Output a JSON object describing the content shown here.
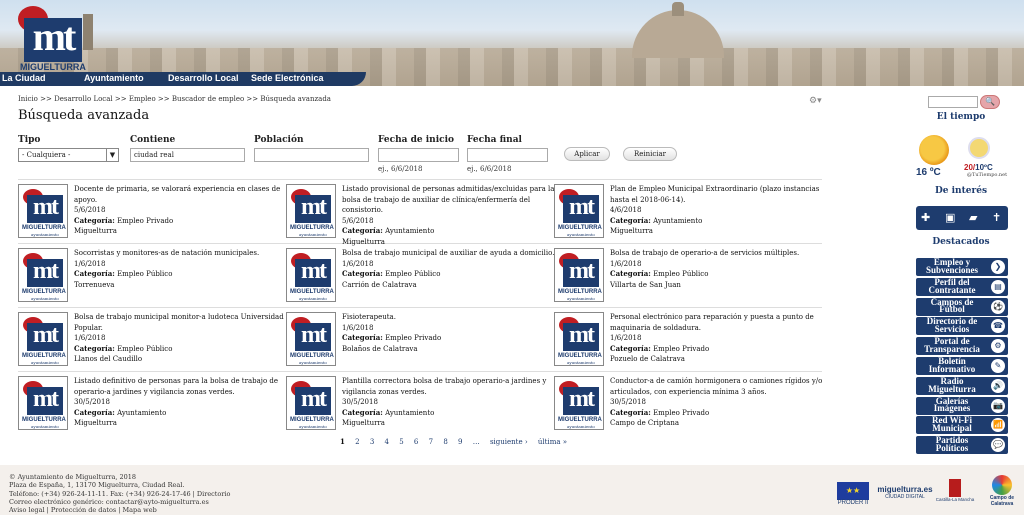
{
  "header": {
    "logo_text": "mt",
    "logo_name": "MIGUELTURRA",
    "nav": [
      {
        "label": "La Ciudad"
      },
      {
        "label": "Ayuntamiento"
      },
      {
        "label": "Desarrollo Local"
      },
      {
        "label": "Sede Electrónica"
      }
    ]
  },
  "breadcrumb": {
    "items": [
      "Inicio",
      ">>",
      "Desarrollo Local",
      ">>",
      "Empleo",
      ">>",
      "Buscador de empleo",
      ">>",
      "Búsqueda avanzada"
    ]
  },
  "page_title": "Búsqueda avanzada",
  "filters": {
    "tipo_label": "Tipo",
    "tipo_value": "- Cualquiera -",
    "contiene_label": "Contiene",
    "contiene_value": "ciudad real",
    "poblacion_label": "Población",
    "poblacion_value": "",
    "fecha_inicio_label": "Fecha de inicio",
    "fecha_inicio_hint": "ej., 6/6/2018",
    "fecha_final_label": "Fecha final",
    "fecha_final_hint": "ej., 6/6/2018",
    "apply_label": "Aplicar",
    "reset_label": "Reiniciar"
  },
  "thumb": {
    "text": "mt",
    "name": "MIGUELTURRA",
    "sub": "ayuntamiento"
  },
  "results": [
    {
      "title": "Docente de primaria, se valorará experiencia en clases de apoyo.",
      "date": "5/6/2018",
      "category_label": "Categoría:",
      "category": "Empleo Privado",
      "place": "Miguelturra"
    },
    {
      "title": "Listado provisional de personas admitidas/excluidas para la bolsa de trabajo de auxiliar de clínica/enfermería del consistorio.",
      "date": "5/6/2018",
      "category_label": "Categoría:",
      "category": "Ayuntamiento",
      "place": "Miguelturra"
    },
    {
      "title": "Plan de Empleo Municipal Extraordinario (plazo instancias hasta el 2018-06-14).",
      "date": "4/6/2018",
      "category_label": "Categoría:",
      "category": "Ayuntamiento",
      "place": "Miguelturra"
    },
    {
      "title": "Socorristas y monitores-as de natación municipales.",
      "date": "1/6/2018",
      "category_label": "Categoría:",
      "category": "Empleo Público",
      "place": "Torrenueva"
    },
    {
      "title": "Bolsa de trabajo municipal de auxiliar de ayuda a domicilio.",
      "date": "1/6/2018",
      "category_label": "Categoría:",
      "category": "Empleo Público",
      "place": "Carrión de Calatrava"
    },
    {
      "title": "Bolsa de trabajo de operario-a de servicios múltiples.",
      "date": "1/6/2018",
      "category_label": "Categoría:",
      "category": "Empleo Público",
      "place": "Villarta de San Juan"
    },
    {
      "title": "Bolsa de trabajo municipal monitor-a ludoteca Universidad Popular.",
      "date": "1/6/2018",
      "category_label": "Categoría:",
      "category": "Empleo Público",
      "place": "Llanos del Caudillo"
    },
    {
      "title": "Fisioterapeuta.",
      "date": "1/6/2018",
      "category_label": "Categoría:",
      "category": "Empleo Privado",
      "place": "Bolaños de Calatrava"
    },
    {
      "title": "Personal electrónico para reparación y puesta a punto de maquinaria de soldadura.",
      "date": "1/6/2018",
      "category_label": "Categoría:",
      "category": "Empleo Privado",
      "place": "Pozuelo de Calatrava"
    },
    {
      "title": "Listado definitivo de personas para la bolsa de trabajo de operario-a jardines y vigilancia zonas verdes.",
      "date": "30/5/2018",
      "category_label": "Categoría:",
      "category": "Ayuntamiento",
      "place": "Miguelturra"
    },
    {
      "title": "Plantilla correctora bolsa de trabajo operario-a jardines y vigilancia zonas verdes.",
      "date": "30/5/2018",
      "category_label": "Categoría:",
      "category": "Ayuntamiento",
      "place": "Miguelturra"
    },
    {
      "title": "Conductor-a de camión hormigonera o camiones rígidos y/o articulados, con experiencia mínima 3 años.",
      "date": "30/5/2018",
      "category_label": "Categoría:",
      "category": "Empleo Privado",
      "place": "Campo de Criptana"
    }
  ],
  "pager": {
    "pages": [
      "1",
      "2",
      "3",
      "4",
      "5",
      "6",
      "7",
      "8",
      "9",
      "…"
    ],
    "current": "1",
    "next": "siguiente ›",
    "last": "última »"
  },
  "sidebar": {
    "search_icon": "🔍",
    "weather_title": "El tiempo",
    "temp_now": "16 ºC",
    "temp_high": "20",
    "temp_low": "10ºC",
    "temp_source": "@TuTiempo.net",
    "interes_title": "De interés",
    "destacados_title": "Destacados",
    "destacados": [
      {
        "label": "Empleo y Subvenciones",
        "icon": "❯"
      },
      {
        "label": "Perfil del Contratante",
        "icon": "▤"
      },
      {
        "label": "Campos de Fútbol",
        "icon": "⚽"
      },
      {
        "label": "Directorio de Servicios",
        "icon": "☎"
      },
      {
        "label": "Portal de Transparencia",
        "icon": "⚙"
      },
      {
        "label": "Boletín Informativo",
        "icon": "✎"
      },
      {
        "label": "Radio Miguelturra",
        "icon": "🔊"
      },
      {
        "label": "Galerías Imágenes",
        "icon": "📷"
      },
      {
        "label": "Red Wi-Fi Municipal",
        "icon": "📶"
      },
      {
        "label": "Partidos Políticos",
        "icon": "💬"
      }
    ]
  },
  "footer": {
    "line1": "© Ayuntamiento de Miguelturra, 2018",
    "line2": "Plaza de España, 1, 13170 Miguelturra, Ciudad Real.",
    "line3": "Teléfono: (+34) 926-24-11-11. Fax: (+34) 926-24-17-46 | Directorio",
    "line4": "Correo electrónico genérico: contactar@ayto-miguelturra.es",
    "line5": "Aviso legal | Protección de datos | Mapa web",
    "logo1": "PRODER II",
    "logo2": "miguelturra.es",
    "logo2b": "CIUDAD DIGITAL",
    "logo3": "Castilla-La Mancha",
    "logo4": "Campo de Calatrava"
  }
}
